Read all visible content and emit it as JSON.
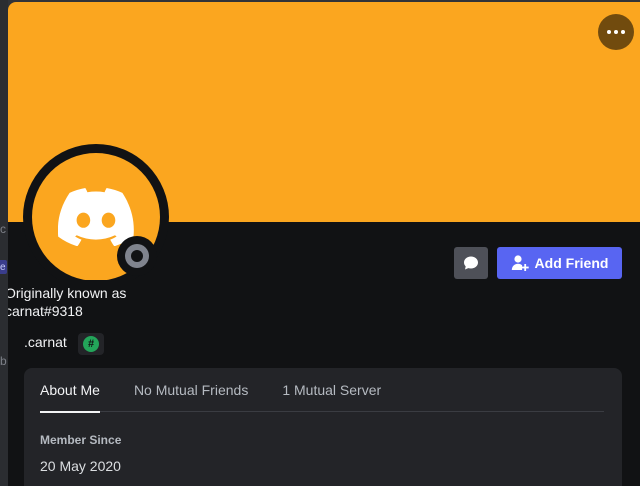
{
  "background": {
    "glyph_1": "c",
    "glyph_2": "e",
    "glyph_3": "b"
  },
  "profile": {
    "banner_color": "#fba61f",
    "avatar_color": "#fba61f",
    "status": "offline",
    "previous_name_line1": "Originally known as",
    "previous_name_line2": "carnat#9318",
    "username": ".carnat",
    "badge_symbol": "#"
  },
  "actions": {
    "more_icon": "more-dots-icon",
    "message_icon": "chat-bubble-icon",
    "add_friend_icon": "add-user-icon",
    "add_friend_label": "Add Friend"
  },
  "tabs": [
    {
      "label": "About Me",
      "active": true
    },
    {
      "label": "No Mutual Friends",
      "active": false
    },
    {
      "label": "1 Mutual Server",
      "active": false
    }
  ],
  "about": {
    "member_since_label": "Member Since",
    "member_since_date": "20 May 2020"
  },
  "colors": {
    "accent": "#5865f2",
    "card_bg": "#111214",
    "panel_bg": "#232428"
  }
}
